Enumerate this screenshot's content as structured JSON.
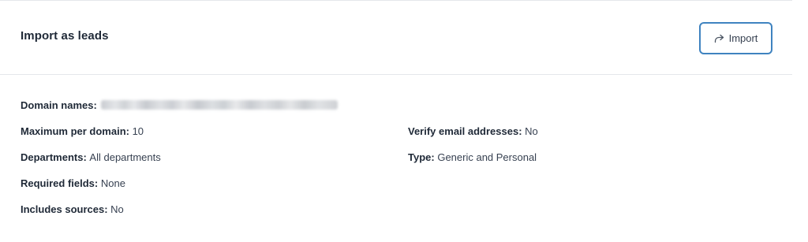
{
  "header": {
    "title": "Import as leads",
    "import_button_label": "Import",
    "import_icon": "share-arrow-icon"
  },
  "details": {
    "domain_names": {
      "label": "Domain names:",
      "value_obscured": true
    },
    "max_per_domain": {
      "label": "Maximum per domain:",
      "value": "10"
    },
    "departments": {
      "label": "Departments:",
      "value": "All departments"
    },
    "required_fields": {
      "label": "Required fields:",
      "value": "None"
    },
    "includes_sources": {
      "label": "Includes sources:",
      "value": "No"
    },
    "verify_email": {
      "label": "Verify email addresses:",
      "value": "No"
    },
    "type": {
      "label": "Type:",
      "value": "Generic and Personal"
    }
  },
  "colors": {
    "button_border": "#3f83c0",
    "divider": "#e5e7eb",
    "text": "#1f2937"
  }
}
